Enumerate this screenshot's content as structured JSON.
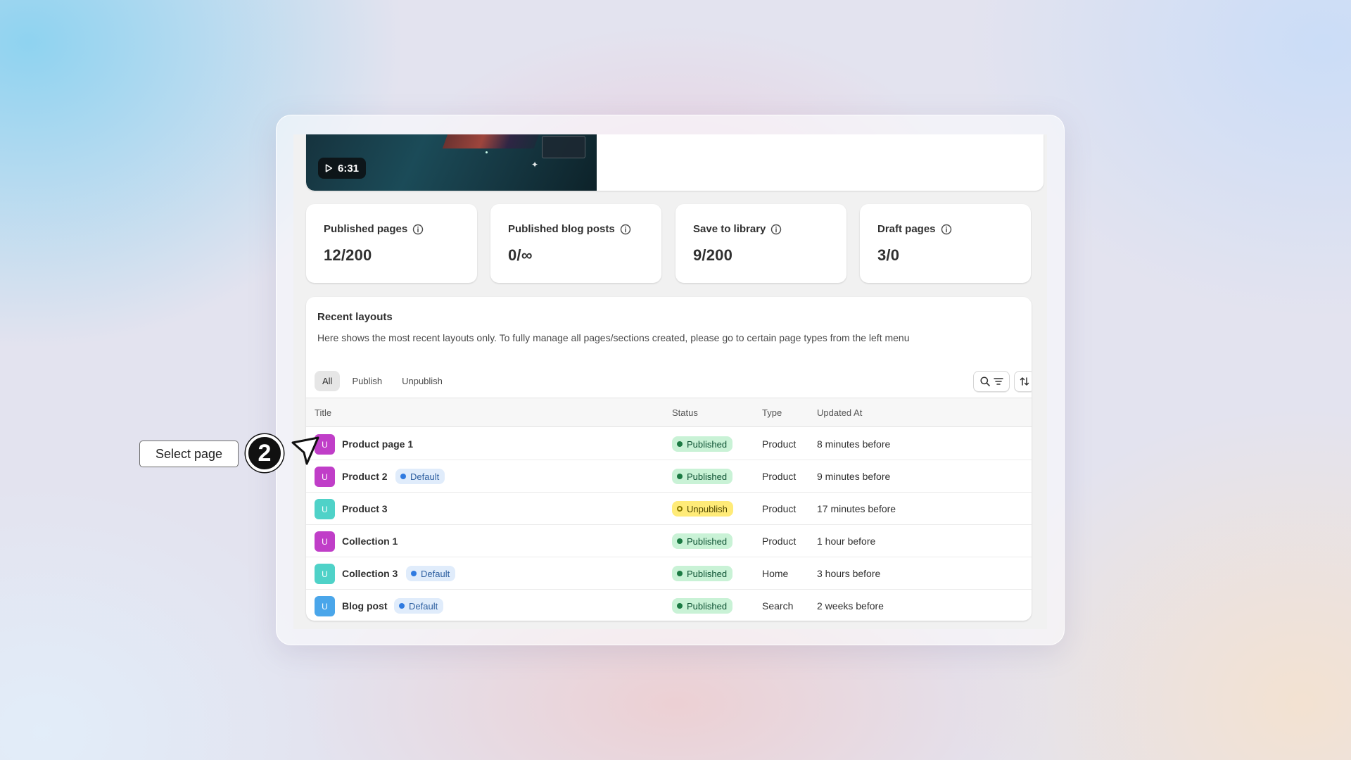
{
  "video": {
    "duration": "6:31"
  },
  "stats": [
    {
      "label": "Published pages",
      "value": "12/200"
    },
    {
      "label": "Published blog posts",
      "value": "0/∞"
    },
    {
      "label": "Save to library",
      "value": "9/200"
    },
    {
      "label": "Draft pages",
      "value": "3/0"
    }
  ],
  "recent": {
    "title": "Recent layouts",
    "description": "Here shows the most recent layouts only. To fully manage all pages/sections created, please go to certain page types from the left menu",
    "tabs": [
      "All",
      "Publish",
      "Unpublish"
    ],
    "active_tab": "All",
    "columns": {
      "title": "Title",
      "status": "Status",
      "type": "Type",
      "updated": "Updated At"
    },
    "rows": [
      {
        "avatar": "U",
        "avatar_color": "#c03ec8",
        "title": "Product page 1",
        "badge": "",
        "status": "Published",
        "type": "Product",
        "updated": "8 minutes before"
      },
      {
        "avatar": "U",
        "avatar_color": "#c03ec8",
        "title": "Product 2",
        "badge": "Default",
        "status": "Published",
        "type": "Product",
        "updated": "9 minutes before"
      },
      {
        "avatar": "U",
        "avatar_color": "#4fd2c8",
        "title": "Product 3",
        "badge": "",
        "status": "Unpublish",
        "type": "Product",
        "updated": "17 minutes before"
      },
      {
        "avatar": "U",
        "avatar_color": "#c03ec8",
        "title": "Collection 1",
        "badge": "",
        "status": "Published",
        "type": "Product",
        "updated": "1 hour before"
      },
      {
        "avatar": "U",
        "avatar_color": "#4fd2c8",
        "title": "Collection 3",
        "badge": "Default",
        "status": "Published",
        "type": "Home",
        "updated": "3 hours before"
      },
      {
        "avatar": "U",
        "avatar_color": "#4aa6ea",
        "title": "Blog post",
        "badge": "Default",
        "status": "Published",
        "type": "Search",
        "updated": "2 weeks before"
      }
    ]
  },
  "annotation": {
    "callout": "Select page",
    "step": "2"
  },
  "icons": {
    "play": "play-icon",
    "info": "info-icon",
    "search": "search-icon",
    "filter": "filter-icon",
    "sort": "sort-icon",
    "cursor": "cursor-arrow-icon"
  }
}
